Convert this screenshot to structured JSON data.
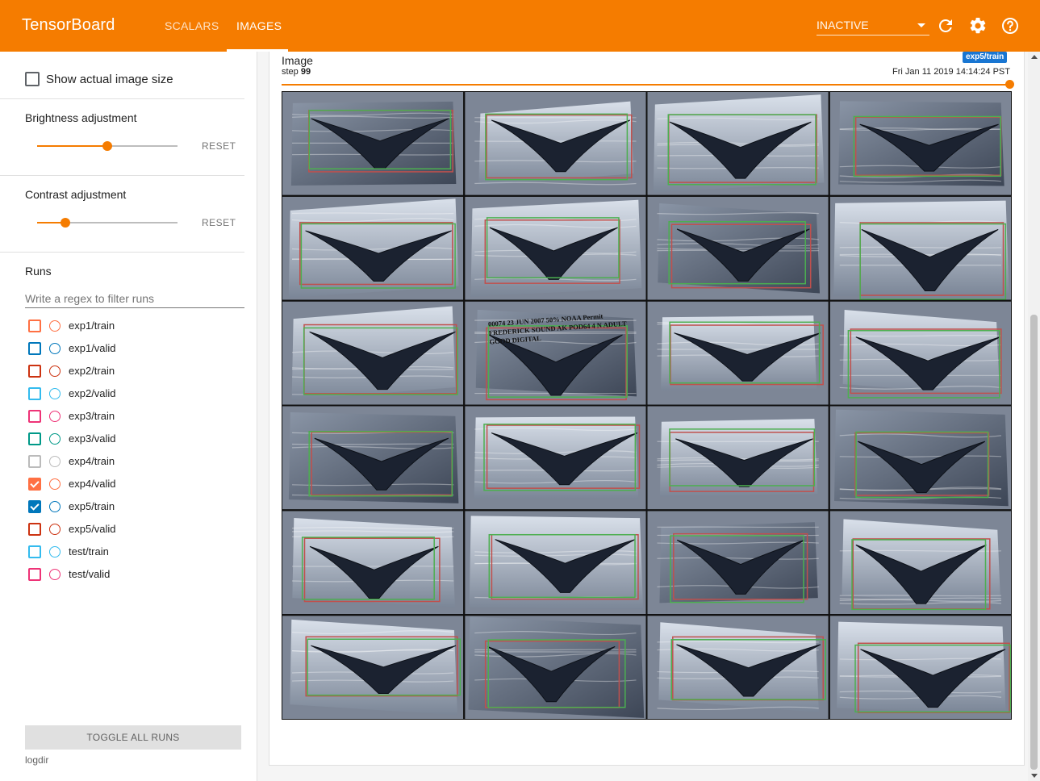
{
  "app": {
    "title": "TensorBoard"
  },
  "header": {
    "tabs": [
      {
        "label": "SCALARS"
      },
      {
        "label": "IMAGES"
      }
    ],
    "status_select": "INACTIVE",
    "icons": [
      "refresh-icon",
      "settings-icon",
      "help-icon"
    ]
  },
  "sidebar": {
    "show_actual_size": {
      "label": "Show actual image size",
      "checked": false
    },
    "brightness": {
      "label": "Brightness adjustment",
      "reset": "RESET",
      "fraction": 0.5
    },
    "contrast": {
      "label": "Contrast adjustment",
      "reset": "RESET",
      "fraction": 0.2
    },
    "runs": {
      "title": "Runs",
      "filter_placeholder": "Write a regex to filter runs",
      "items": [
        {
          "name": "exp1/train",
          "color": "#ff7043",
          "checked": false
        },
        {
          "name": "exp1/valid",
          "color": "#0077bb",
          "checked": false
        },
        {
          "name": "exp2/train",
          "color": "#cc3311",
          "checked": false
        },
        {
          "name": "exp2/valid",
          "color": "#33bbee",
          "checked": false
        },
        {
          "name": "exp3/train",
          "color": "#ee3377",
          "checked": false
        },
        {
          "name": "exp3/valid",
          "color": "#009988",
          "checked": false
        },
        {
          "name": "exp4/train",
          "color": "#bbbbbb",
          "checked": false
        },
        {
          "name": "exp4/valid",
          "color": "#ff7043",
          "checked": true
        },
        {
          "name": "exp5/train",
          "color": "#0077bb",
          "checked": true
        },
        {
          "name": "exp5/valid",
          "color": "#cc3311",
          "checked": false
        },
        {
          "name": "test/train",
          "color": "#33bbee",
          "checked": false
        },
        {
          "name": "test/valid",
          "color": "#ee3377",
          "checked": false
        }
      ],
      "toggle_all": "TOGGLE ALL RUNS"
    },
    "logdir": "logdir"
  },
  "image_card": {
    "title": "Image",
    "step_prefix": "step",
    "step_value": "99",
    "run_chip": "exp5/train",
    "timestamp": "Fri Jan 11 2019 14:14:24 PST",
    "step_fraction": 1.0,
    "grid": {
      "rows": 6,
      "cols": 4,
      "content": "whale tail flukes with red and green bounding boxes"
    },
    "overlay_text": [
      "00074 23 JUN 2007 50% NOAA Permit",
      "FREDERICK SOUND AK POD64 4 N ADULT",
      "GOOD DIGITAL"
    ],
    "colors": {
      "accent": "#f57c00",
      "box_red": "#c0504d",
      "box_green": "#4caf50"
    }
  }
}
